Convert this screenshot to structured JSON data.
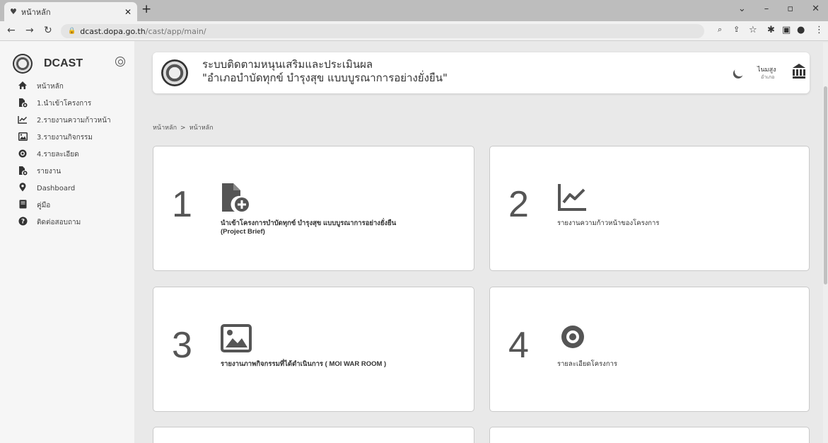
{
  "browser": {
    "tab_title": "หน้าหลัก",
    "url_host": "dcast.dopa.go.th",
    "url_path": "/cast/app/main/"
  },
  "sidebar": {
    "brand": "DCAST",
    "items": [
      {
        "label": "หน้าหลัก",
        "icon": "home-icon"
      },
      {
        "label": "1.นำเข้าโครงการ",
        "icon": "file-add-icon"
      },
      {
        "label": "2.รายงานความก้าวหน้า",
        "icon": "chart-line-icon"
      },
      {
        "label": "3.รายงานกิจกรรม",
        "icon": "image-icon"
      },
      {
        "label": "4.รายละเอียด",
        "icon": "eye-icon"
      },
      {
        "label": "รายงาน",
        "icon": "file-add-icon"
      },
      {
        "label": "Dashboard",
        "icon": "map-pin-icon"
      },
      {
        "label": "คู่มือ",
        "icon": "book-icon"
      },
      {
        "label": "ติดต่อสอบถาม",
        "icon": "question-icon"
      }
    ]
  },
  "header": {
    "title": "ระบบติดตามหนุนเสริมและประเมินผล",
    "subtitle": "\"อำเภอบำบัดทุกข์ บำรุงสุข แบบบูรณาการอย่างยั่งยืน\"",
    "user_name": "ไนมสูง",
    "user_role": "อำเภอ"
  },
  "breadcrumb": {
    "parent": "หน้าหลัก",
    "separator": ">",
    "current": "หน้าหลัก"
  },
  "cards": [
    {
      "number": "1",
      "icon": "file-add-icon",
      "label": "นำเข้าโครงการบำบัดทุกข์ บำรุงสุข แบบบูรณาการอย่างยั่งยืน",
      "label2": "(Project Brief)"
    },
    {
      "number": "2",
      "icon": "chart-line-icon",
      "label": "รายงานความก้าวหน้าของโครงการ",
      "label2": ""
    },
    {
      "number": "3",
      "icon": "image-icon",
      "label": "รายงานภาพกิจกรรมที่ได้ดำเนินการ ( MOI WAR ROOM )",
      "label2": ""
    },
    {
      "number": "4",
      "icon": "eye-icon",
      "label": "รายละเอียดโครงการ",
      "label2": ""
    }
  ]
}
